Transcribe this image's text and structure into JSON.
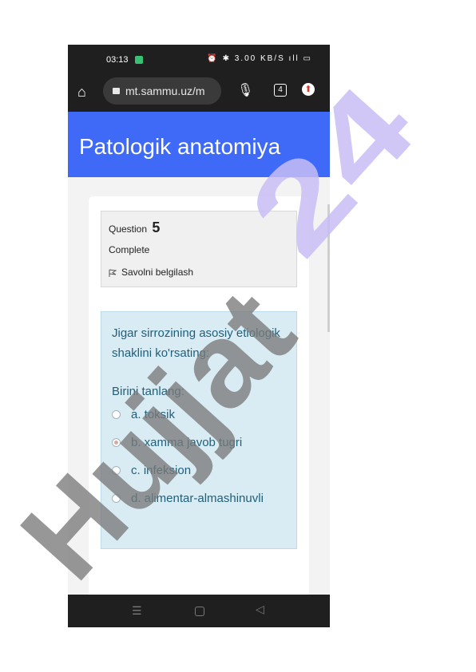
{
  "status_bar": {
    "time": "03:13",
    "icons_text": "⏰ ✱ 3.00 KB/S ıll ▭"
  },
  "browser": {
    "url": "mt.sammu.uz/m",
    "tab_count": "4"
  },
  "site": {
    "title": "Patologik anatomiya"
  },
  "question_info": {
    "label": "Question",
    "number": "5",
    "state": "Complete",
    "flag_label": "Savolni belgilash"
  },
  "question": {
    "text": "Jigar sirrozining asosiy etiologik shaklini ko'rsating:",
    "prompt": "Birini tanlang:",
    "options": [
      {
        "label": "a. toksik",
        "selected": false
      },
      {
        "label": "b. xamma javob tugri",
        "selected": true
      },
      {
        "label": "c. infeksion",
        "selected": false
      },
      {
        "label": "d. alimentar-almashinuvli",
        "selected": false
      }
    ]
  },
  "watermark": {
    "text": "Hujjat24",
    "color_dark": "#7a7a7a",
    "color_light": "#c8bdf6"
  },
  "colors": {
    "header": "#3f6af7",
    "formulation_bg": "#d9ecf4",
    "answer_text": "#1f5f7a"
  }
}
